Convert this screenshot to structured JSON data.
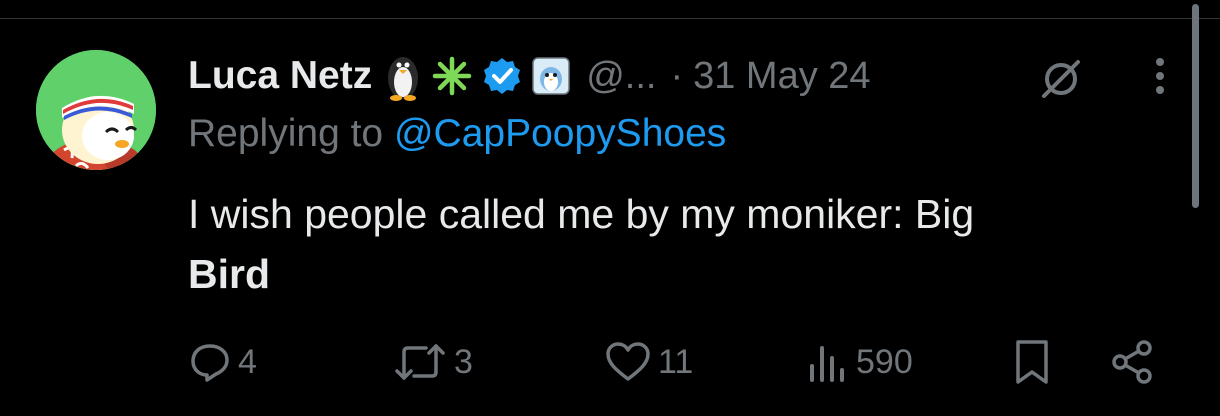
{
  "tweet": {
    "author_name": "Luca Netz",
    "handle": "@...",
    "separator": "·",
    "date": "31 May 24",
    "replying_prefix": "Replying to",
    "replying_to": "@CapPoopyShoes",
    "body_main": "I wish people called me by my moniker: Big",
    "body_bold": "Bird",
    "badges": [
      "penguin-emoji",
      "green-asterisk-emoji",
      "verified-badge",
      "penguin-affiliate-badge"
    ]
  },
  "actions": {
    "replies": "4",
    "reposts": "3",
    "likes": "11",
    "views": "590"
  },
  "colors": {
    "background": "#000000",
    "text": "#e7e9ea",
    "muted": "#71767b",
    "accent": "#1d9bf0",
    "avatar_bg": "#5fd06a"
  }
}
